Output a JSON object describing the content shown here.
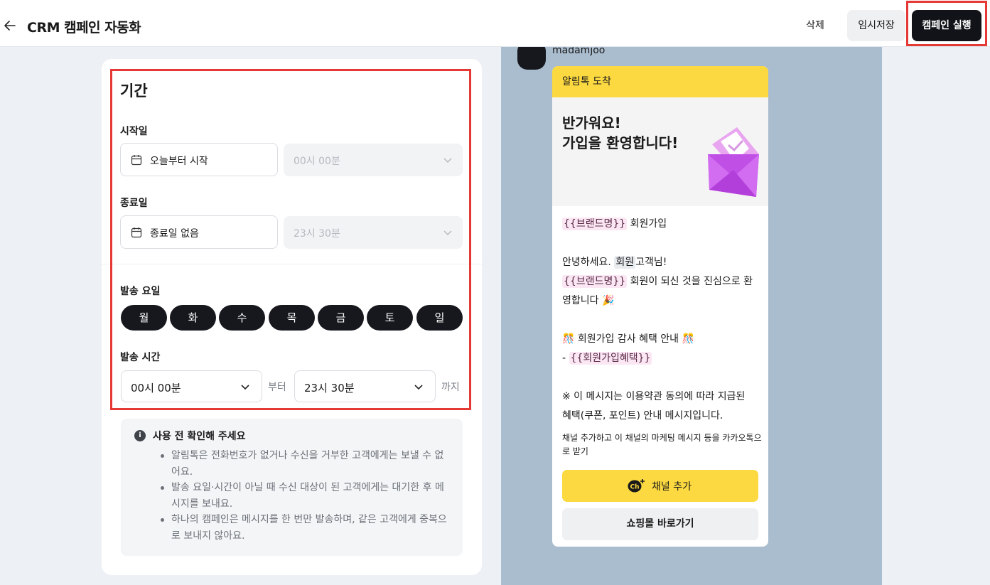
{
  "header": {
    "title": "CRM 캠페인 자동화",
    "delete_label": "삭제",
    "save_label": "임시저장",
    "run_label": "캠페인 실행"
  },
  "period": {
    "title": "기간",
    "start_label": "시작일",
    "start_value": "오늘부터 시작",
    "start_time": "00시 00분",
    "end_label": "종료일",
    "end_value": "종료일 없음",
    "end_time": "23시 30분",
    "days_label": "발송 요일",
    "days": [
      "월",
      "화",
      "수",
      "목",
      "금",
      "토",
      "일"
    ],
    "time_label": "발송 시간",
    "time_from": "00시 00분",
    "from_word": "부터",
    "time_to": "23시 30분",
    "to_word": "까지"
  },
  "notice": {
    "title": "사용 전 확인해 주세요",
    "items": [
      "알림톡은 전화번호가 없거나 수신을 거부한 고객에게는 보낼 수 없어요.",
      "발송 요일·시간이 아닐 때 수신 대상이 된 고객에게는 대기한 후 메시지를 보내요.",
      "하나의 캠페인은 메시지를 한 번만 발송하며, 같은 고객에게 중복으로 보내지 않아요."
    ]
  },
  "preview": {
    "sender": "madamjoo",
    "bubble_header": "알림톡 도착",
    "hero_line1": "반가워요!",
    "hero_line2": "가입을 환영합니다!",
    "tag_brand": "{{브랜드명}}",
    "signup": "회원가입",
    "greeting": "안녕하세요.",
    "member": "회원",
    "customer": "고객님!",
    "welcome": "회원이 되신 것을 진심으로 환",
    "welcome2": "영합니다",
    "party": "🎉",
    "confetti": "🎊",
    "benefit_title": "회원가입 감사 혜택 안내",
    "dash": "-",
    "tag_benefit": "{{회원가입혜택}}",
    "disclaimer1": "※ 이 메시지는 이용약관 동의에 따라 지급된",
    "disclaimer2": "혜택(쿠폰, 포인트) 안내 메시지입니다.",
    "small": "채널 추가하고 이 채널의 마케팅 메시지 등을 카카오톡으로 받기",
    "channel_button": "채널 추가",
    "channel_icon_text": "Ch",
    "shop_button": "쇼핑몰 바로가기"
  }
}
